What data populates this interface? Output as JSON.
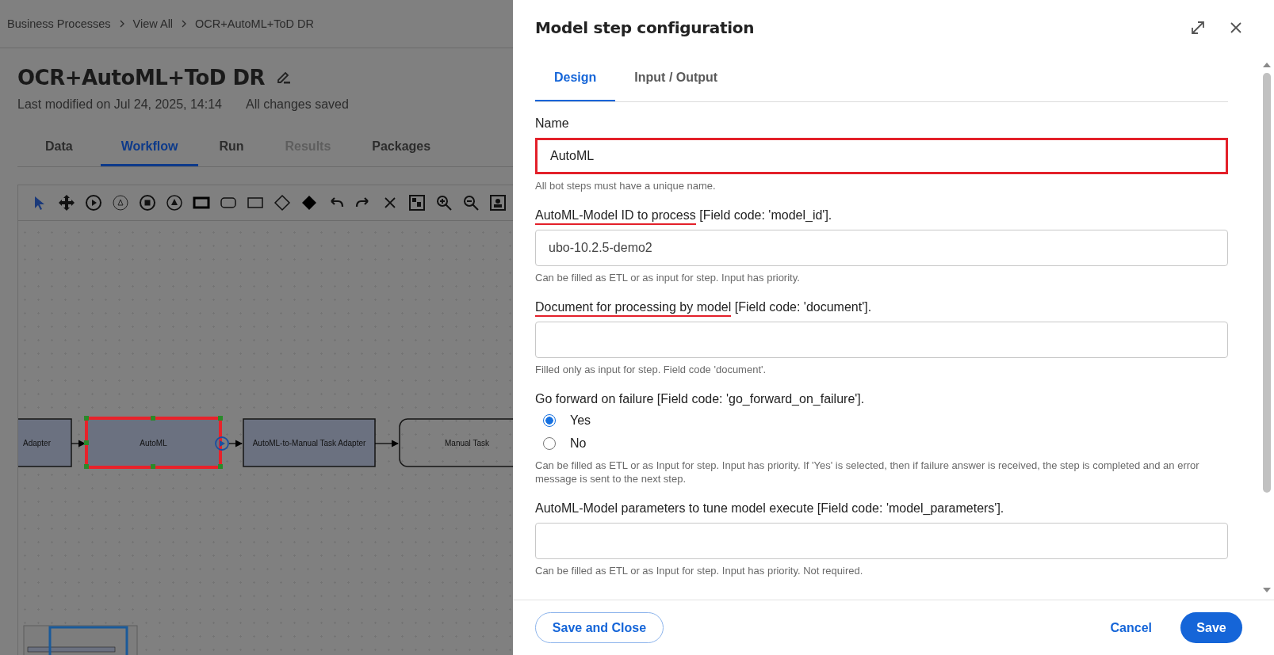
{
  "breadcrumb": [
    {
      "label": "Business Processes"
    },
    {
      "label": "View All"
    },
    {
      "label": "OCR+AutoML+ToD DR"
    }
  ],
  "page": {
    "title": "OCR+AutoML+ToD DR",
    "modified": "Last modified on Jul 24, 2025, 14:14",
    "save_status": "All changes saved"
  },
  "tabs": [
    {
      "label": "Data",
      "selected": false,
      "disabled": false
    },
    {
      "label": "Workflow",
      "selected": true,
      "disabled": false
    },
    {
      "label": "Run",
      "selected": false,
      "disabled": false
    },
    {
      "label": "Results",
      "selected": false,
      "disabled": true
    },
    {
      "label": "Packages",
      "selected": false,
      "disabled": false
    }
  ],
  "diagram": {
    "nodes": [
      {
        "label": "Adapter",
        "kind": "task",
        "highlighted": false
      },
      {
        "label": "AutoML",
        "kind": "task",
        "highlighted": true
      },
      {
        "label": "AutoML-to-Manual Task Adapter",
        "kind": "task",
        "highlighted": false
      },
      {
        "label": "Manual Task",
        "kind": "user",
        "highlighted": false
      }
    ]
  },
  "dialog": {
    "title": "Model step configuration",
    "tabs": [
      {
        "label": "Design",
        "selected": true
      },
      {
        "label": "Input / Output",
        "selected": false
      }
    ],
    "fields": [
      {
        "kind": "text",
        "label": "Name",
        "value": "AutoML",
        "help": "All bot steps must have a unique name.",
        "highlighted": true
      },
      {
        "kind": "text",
        "label_marked": "AutoML-Model ID to process",
        "label": " [Field code: 'model_id'].",
        "value": "ubo-10.2.5-demo2",
        "help": "Can be filled as ETL or as input for step. Input has priority.",
        "highlighted": false
      },
      {
        "kind": "text",
        "label_marked": "Document for processing by model",
        "label": " [Field code: 'document'].",
        "help": "Filled only as input for step. Field code 'document'.",
        "highlighted": false
      },
      {
        "kind": "radio",
        "label": "Go forward on failure [Field code: 'go_forward_on_failure'].",
        "options": [
          {
            "label": "Yes",
            "selected": true
          },
          {
            "label": "No",
            "selected": false
          }
        ],
        "help": "Can be filled as ETL or as Input for step. Input has priority. If 'Yes' is selected, then if failure answer is received, the step is completed and an error message is sent to the next step."
      },
      {
        "kind": "text",
        "label": "AutoML-Model parameters to tune model execute [Field code: 'model_parameters'].",
        "help": "Can be filled as ETL or as Input for step. Input has priority. Not required.",
        "highlighted": false
      }
    ],
    "buttons": [
      {
        "label": "Save and Close",
        "kind": "outline"
      },
      {
        "label": "Cancel",
        "kind": "text"
      },
      {
        "label": "Save",
        "kind": "primary"
      }
    ]
  }
}
